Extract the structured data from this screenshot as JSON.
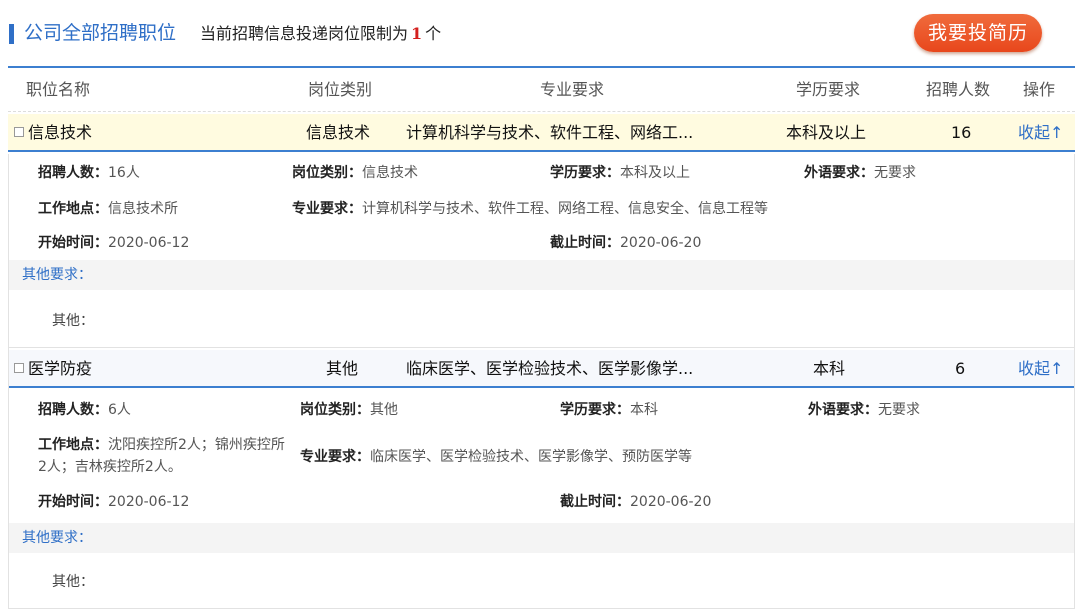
{
  "header": {
    "title": "公司全部招聘职位",
    "limit_prefix": "当前招聘信息投递岗位限制为",
    "limit_count": "1",
    "limit_suffix": "个",
    "apply_button": "我要投简历"
  },
  "table": {
    "headers": [
      "职位名称",
      "岗位类别",
      "专业要求",
      "学历要求",
      "招聘人数",
      "操作"
    ]
  },
  "jobs": [
    {
      "name": "信息技术",
      "category": "信息技术",
      "major": "计算机科学与技术、软件工程、网络工...",
      "education": "本科及以上",
      "count": "16",
      "action": "收起↑",
      "detail": {
        "count_label": "招聘人数：",
        "count_value": "16人",
        "category_label": "岗位类别：",
        "category_value": "信息技术",
        "education_label": "学历要求：",
        "education_value": "本科及以上",
        "language_label": "外语要求：",
        "language_value": "无要求",
        "location_label": "工作地点：",
        "location_value": "信息技术所",
        "major_label": "专业要求：",
        "major_value": "计算机科学与技术、软件工程、网络工程、信息安全、信息工程等",
        "start_label": "开始时间：",
        "start_value": "2020-06-12",
        "end_label": "截止时间：",
        "end_value": "2020-06-20",
        "other_head": "其他要求：",
        "other_body": "其他："
      }
    },
    {
      "name": "医学防疫",
      "category": "其他",
      "major": "临床医学、医学检验技术、医学影像学...",
      "education": "本科",
      "count": "6",
      "action": "收起↑",
      "detail": {
        "count_label": "招聘人数：",
        "count_value": "6人",
        "category_label": "岗位类别：",
        "category_value": "其他",
        "education_label": "学历要求：",
        "education_value": "本科",
        "language_label": "外语要求：",
        "language_value": "无要求",
        "location_label": "工作地点：",
        "location_value": "沈阳疾控所2人；锦州疾控所2人；吉林疾控所2人。",
        "major_label": "专业要求：",
        "major_value": "临床医学、医学检验技术、医学影像学、预防医学等",
        "start_label": "开始时间：",
        "start_value": "2020-06-12",
        "end_label": "截止时间：",
        "end_value": "2020-06-20",
        "other_head": "其他要求：",
        "other_body": "其他："
      }
    }
  ]
}
